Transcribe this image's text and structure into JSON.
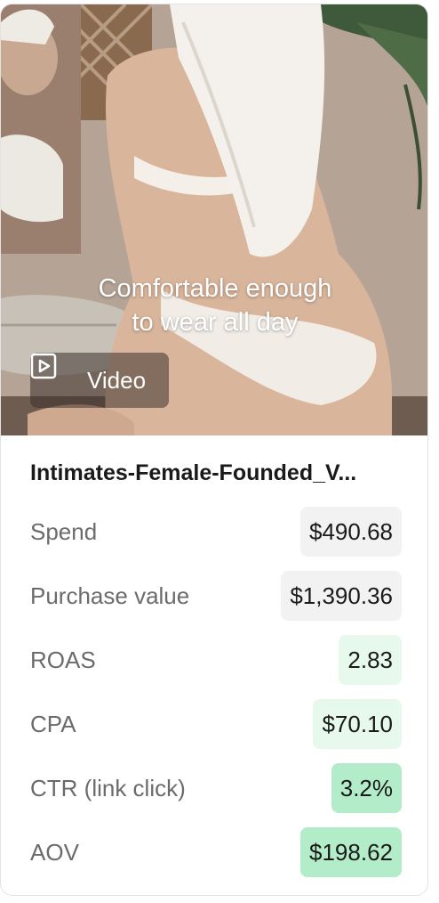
{
  "card": {
    "caption": "Comfortable enough\nto wear all day",
    "video_label": "Video",
    "play_icon": "play-square-icon",
    "title": "Intimates-Female-Founded_V...",
    "metrics": [
      {
        "label": "Spend",
        "value": "$490.68",
        "bg": "#f2f2f2"
      },
      {
        "label": "Purchase value",
        "value": "$1,390.36",
        "bg": "#f2f2f2"
      },
      {
        "label": "ROAS",
        "value": "2.83",
        "bg": "#e7f8ec"
      },
      {
        "label": "CPA",
        "value": "$70.10",
        "bg": "#e7f8ec"
      },
      {
        "label": "CTR (link click)",
        "value": "3.2%",
        "bg": "#b3ecc8"
      },
      {
        "label": "AOV",
        "value": "$198.62",
        "bg": "#b3ecc8"
      }
    ]
  }
}
